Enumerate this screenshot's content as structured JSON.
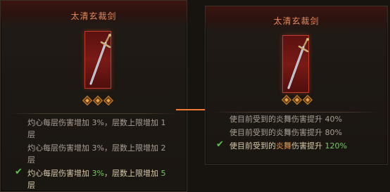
{
  "left_panel": {
    "title": "太清玄裁剑",
    "effects": [
      {
        "pre": "灼心每层伤害增加 3%，层数上限增加 1",
        "line2": "层",
        "active": false
      },
      {
        "pre": "灼心每层伤害增加 3%，层数上限增加 2",
        "line2": "层",
        "active": false
      },
      {
        "p1": "灼心每层伤害增加 ",
        "v1": "3%",
        "p2": "，层数上限增加 ",
        "v2": "5",
        "line2": "层",
        "active": true
      }
    ]
  },
  "right_panel": {
    "title": "太清玄裁剑",
    "effects": [
      {
        "text": "使目前受到的炎舞伤害提升 40%",
        "active": false
      },
      {
        "text": "使目前受到的炎舞伤害提升 80%",
        "active": false
      },
      {
        "p1": "使目前受到的",
        "kw": "炎舞",
        "p2": "伤害提升 ",
        "val": "120%",
        "active": true
      }
    ]
  },
  "colors": {
    "title": "#e8895a",
    "check": "#5fc24a",
    "highlight_green": "#6fce5a",
    "highlight_orange": "#e99545",
    "arrow": "#f07a32"
  },
  "icons": [
    "sword-icon",
    "gem-icon",
    "check-icon",
    "arrow-right-icon"
  ]
}
